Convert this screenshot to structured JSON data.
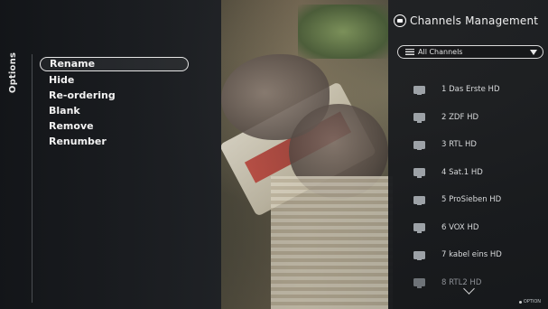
{
  "options": {
    "title": "Options",
    "items": [
      "Rename",
      "Hide",
      "Re-ordering",
      "Blank",
      "Remove",
      "Renumber"
    ],
    "selected_index": 0
  },
  "channels": {
    "title": "Channels Management",
    "filter_label": "All Channels",
    "list": [
      "1 Das Erste HD",
      "2 ZDF HD",
      "3 RTL HD",
      "4 Sat.1 HD",
      "5 ProSieben HD",
      "6 VOX HD",
      "7 kabel eins HD",
      "8 RTL2 HD"
    ],
    "footer_hint": "OPTION"
  },
  "icons": {
    "header": "tv-icon",
    "channel": "tv-icon",
    "filter": "list-icon",
    "dropdown": "triangle-down-icon",
    "scroll": "chevron-down-icon"
  }
}
